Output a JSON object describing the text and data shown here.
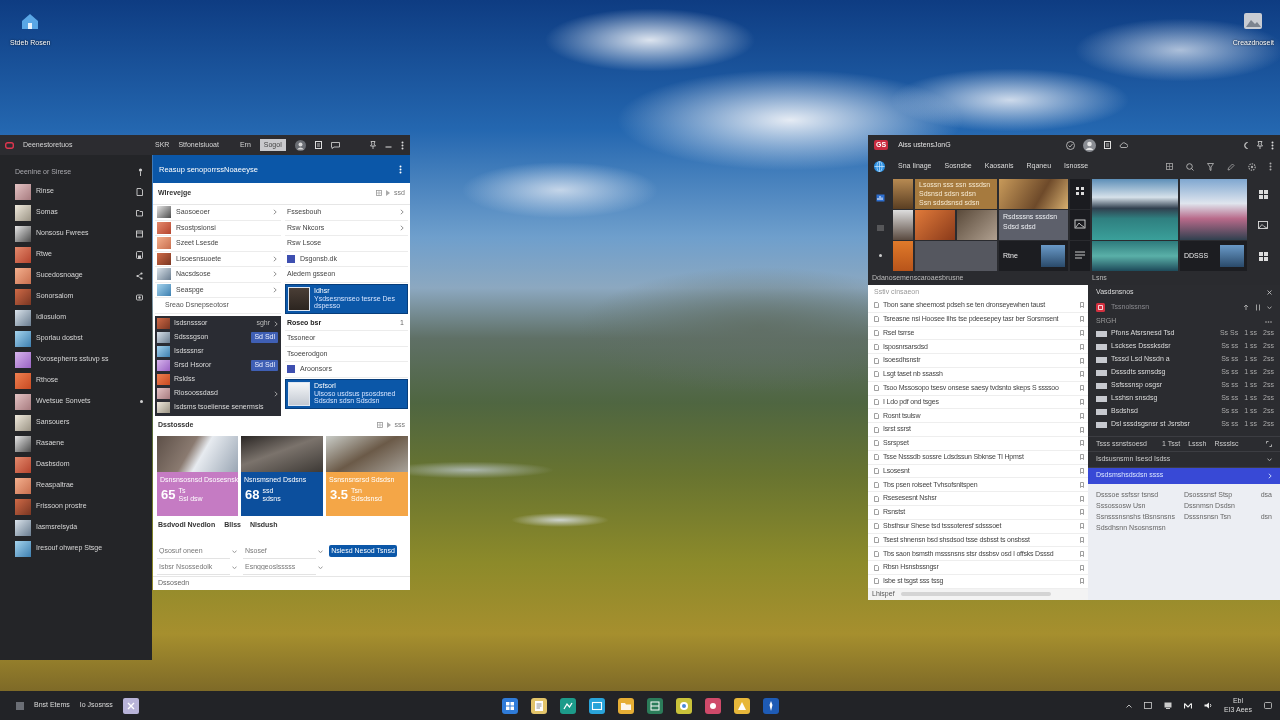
{
  "desktop_icons": [
    {
      "label": "Stdeb Rosen"
    },
    {
      "label": "Creazdnoseit"
    }
  ],
  "left_window": {
    "title": "Deenestoretuos",
    "menu": [
      "SKR",
      "Stfonelsiuoat",
      "Ern"
    ],
    "menu_button": "Sogol",
    "sidebar": {
      "header": "Deenine or Sirese",
      "items": [
        {
          "label": "Rinse",
          "kind": "icon"
        },
        {
          "label": "Somas",
          "kind": "icon"
        },
        {
          "label": "Nonsosu Fwrees",
          "kind": "icon"
        },
        {
          "label": "Rtwe",
          "kind": "icon"
        },
        {
          "label": "Sucedosnoage",
          "kind": "icon"
        },
        {
          "label": "Sonorsalom",
          "kind": "icon"
        },
        {
          "label": "Idiosulom",
          "kind": "plain"
        },
        {
          "label": "Sporlau dosbst",
          "kind": "plain"
        },
        {
          "label": "Yorosepherrs sstuvp ss",
          "kind": "plain"
        },
        {
          "label": "Rthose",
          "kind": "plain"
        },
        {
          "label": "Wvetsue Sonvets",
          "kind": "dot"
        },
        {
          "label": "Sansouers",
          "kind": "plain"
        },
        {
          "label": "Rasaene",
          "kind": "plain"
        },
        {
          "label": "Dasbsdom",
          "kind": "plain"
        },
        {
          "label": "Reaspaltrae",
          "kind": "plain"
        },
        {
          "label": "Frissoon prostre",
          "kind": "plain"
        },
        {
          "label": "Iasmsrelsyda",
          "kind": "plain"
        },
        {
          "label": "Iresouf ohwrep Stsge",
          "kind": "plain"
        }
      ]
    },
    "header": "Reasup senoporrssNoaeeyse",
    "section_title": "Wlrevejge",
    "section_link": "ssd",
    "list_left": [
      {
        "label": "Saosoeoer",
        "kind": "nav"
      },
      {
        "label": "Rsostpsionsi",
        "kind": "plain"
      },
      {
        "label": "Szeet Lsesde",
        "kind": "plain"
      },
      {
        "label": "Lisoesnsuoete",
        "kind": "nav"
      },
      {
        "label": "Nacsdsose",
        "kind": "nav"
      },
      {
        "label": "Seaspge",
        "kind": "nav"
      }
    ],
    "list_left_link": "Sreao Dsnepseotosr",
    "list_right": [
      {
        "label": "Fssesbouh",
        "kind": "nav"
      },
      {
        "label": "Rsw Nkcors",
        "kind": "nav"
      },
      {
        "label": "Rsw Lsose",
        "kind": "plain"
      },
      {
        "label": "Dsgonsb.dk",
        "kind": "swatch"
      },
      {
        "label": "Aledem gsseon",
        "kind": "plain"
      }
    ],
    "card_1": {
      "title": "Idhsr",
      "text": "Ysdsesnsnseo tesrse Des dspesso"
    },
    "dark_list": [
      {
        "label": "Isdsnsssor",
        "kind": "nav",
        "note": "sghr"
      },
      {
        "label": "Sdsssgson",
        "kind": "button",
        "note": "Sd Sdl"
      },
      {
        "label": "Isdsssnsr",
        "kind": "plain"
      },
      {
        "label": "Srsd Hsoror",
        "kind": "button",
        "note": "Sd Sdl"
      },
      {
        "label": "Rsldss",
        "kind": "plain"
      },
      {
        "label": "Rlosoossdasd",
        "kind": "nav"
      },
      {
        "label": "Isdsms tsoeiiense senermsis",
        "kind": "plain"
      }
    ],
    "list_right_2": [
      {
        "label": "Roseo bsr",
        "kind": "count",
        "count": "1"
      },
      {
        "label": "Tssoneor",
        "kind": "plain"
      },
      {
        "label": "Tsoeerodgon",
        "kind": "plain"
      },
      {
        "label": "Aroonsors",
        "kind": "swatch"
      }
    ],
    "card_2": {
      "title": "Dsfsorl",
      "text": "Ulsoso usdsus psosdsned Sdsdsn sdsn Sdsdsn"
    },
    "section_2_title": "Dsstossde",
    "section_2_link": "sss",
    "cards": [
      {
        "title": "Dsnsnsosnsd Dsosesnsk",
        "value": "65",
        "unit": "Ts",
        "note": "Ssl dsw",
        "color": "#c57bc3"
      },
      {
        "title": "Nsnsmsned Dsdsns",
        "value": "68",
        "unit": "ssd",
        "note": "sdsns",
        "color": "#0c4f9d"
      },
      {
        "title": "Ssnsnsnsrsd Sdsdsn",
        "value": "3.5",
        "unit": "Tsn",
        "note": "Sdsdsnsd",
        "color": "#f4a647"
      }
    ],
    "links": [
      "Bsdvodl Nvedlon",
      "Bllss",
      "Nlsdush"
    ],
    "fields": [
      {
        "placeholder": "Qsosuf oneen"
      },
      {
        "placeholder": "Nsosef"
      },
      {
        "placeholder": "Isbsr Nsossedolk"
      },
      {
        "placeholder": "Esnggeoslsssss"
      }
    ],
    "button": "Nsiesd Nesod Tsnsd",
    "footer": "Dssosedn"
  },
  "right_window": {
    "badge": "GS",
    "title": "Aiss ustensJonG",
    "nav": [
      "Sna Iinage",
      "Sosnsbe",
      "Kaosanis",
      "Rqaneu",
      "Isnosse"
    ],
    "text_card": {
      "lines": [
        "Lsossn sss ssn sssdsn",
        "Sdsnsd sdsn sdsn",
        "Ssn sdsdsnsd sdsn"
      ]
    },
    "summary_card": {
      "lines": [
        "Rsdsssns sssdsn",
        "Sdsd  sdsd"
      ]
    },
    "tile_labels": [
      "Rtne",
      "DDSSS"
    ],
    "caption": "Ddanosemenscaroaesbrusne",
    "panel_caption": "Lsns",
    "list": {
      "header": "Sstiv cinsaeon",
      "rows": [
        "Tbon sane sheemost pdseh se ten dronseyewhen taust",
        "Tsreasne nsi Hoosee Ilhs tse pdeesepey tasr ber Sorsmsent",
        "Rsel tsrrse",
        "Isposnrsarsdsd",
        "Isoesdhsnstr",
        "Lsgt taset nb ssassh",
        "Tsoo Mssosopo tsesv onsese saesy tvdsnto skeps S ssssoo",
        "I Ldo pdf ond tsges",
        "Rosnt tsulsw",
        "Isrst ssrst",
        "Ssrspset",
        "Tsse Nsssdb sossre Ldsdssun Sbknse Tl Hpmst",
        "Lsosesnt",
        "Tbs psen roiseet Tvhsofsnltspen",
        "Rsesesesnt Nshsr",
        "Rsnstst",
        "Sbsthsur Shese tsd tsssoteresf sdsssoet",
        "Tsest shnensn bsd shsdsod tsse dsbsst ts onsbsst",
        "Tbs saon bsmsth msssnsns stsr dssbsv osd l offsks Dsssd",
        "Rbsn Hsnsbssngsr",
        "Isbe st tsgst sss tssg"
      ],
      "footer": "Lhispef"
    },
    "panel": {
      "title": "Vasdsnsnos",
      "toolbar_label": "Tssnolssnsn",
      "group": "SRGH",
      "rows": [
        {
          "name": "Pfons Atsrsnesd Tsd",
          "cells": [
            "Ss Ss",
            "1 ss",
            "2ss"
          ]
        },
        {
          "name": "Lsckses Dsssksdsr",
          "cells": [
            "Ss ss",
            "1 ss",
            "2ss"
          ]
        },
        {
          "name": "Tsssd Lsd Nssdn a",
          "cells": [
            "Ss ss",
            "1 ss",
            "2ss"
          ]
        },
        {
          "name": "Dsssdts ssmsdsg",
          "cells": [
            "Ss ss",
            "1 ss",
            "2ss"
          ]
        },
        {
          "name": "Ssfsssnsp osgsr",
          "cells": [
            "Ss ss",
            "1 ss",
            "2ss"
          ]
        },
        {
          "name": "Lsshsn snsdsg",
          "cells": [
            "Ss ss",
            "1 ss",
            "2ss"
          ]
        },
        {
          "name": "Bsdshsd",
          "cells": [
            "Ss ss",
            "1 ss",
            "2ss"
          ]
        },
        {
          "name": "Dsl sssdsgsnsr st Jsrsbsr",
          "cells": [
            "Ss ss",
            "1 ss",
            "2ss"
          ]
        }
      ],
      "summary": [
        "Tsss ssnstsoesd",
        "1 Tsst",
        "Lsssh",
        "Rssslsc"
      ],
      "accordion": [
        {
          "label": "Isdsusnsmn Isesd Isdss",
          "selected": false
        },
        {
          "label": "Dsdsmshsdsdsn ssss",
          "selected": true
        }
      ],
      "details": [
        {
          "left": "Dsssoe ssfssr tsnsd",
          "right": "Dsosssnsf Stsp",
          "extra": "dsa"
        },
        {
          "left": "Sssossosw Usn",
          "right": "Dssnmsn Dsdsn"
        },
        {
          "left": "Ssnsssnsnshs tBsnsnsns",
          "right": "Dsssnsnsn Tsn",
          "extra": "dsn"
        },
        {
          "left": "Sdsdhsnn Nsosnsmsn"
        }
      ]
    }
  },
  "taskbar": {
    "labels": [
      "Bnst Etems",
      "Io Jsosnss"
    ],
    "apps": [
      {
        "color": "#2f7bd8"
      },
      {
        "color": "#e3c46a"
      },
      {
        "color": "#1d9b8a"
      },
      {
        "color": "#29a3d9"
      },
      {
        "color": "#e6ae35"
      },
      {
        "color": "#2c7c5a"
      },
      {
        "color": "#c9c23a"
      },
      {
        "color": "#cf4a6a"
      },
      {
        "color": "#e7b73a"
      },
      {
        "color": "#1e5bb5"
      }
    ],
    "clock": [
      "Ebl",
      "EI3 Aees"
    ]
  }
}
